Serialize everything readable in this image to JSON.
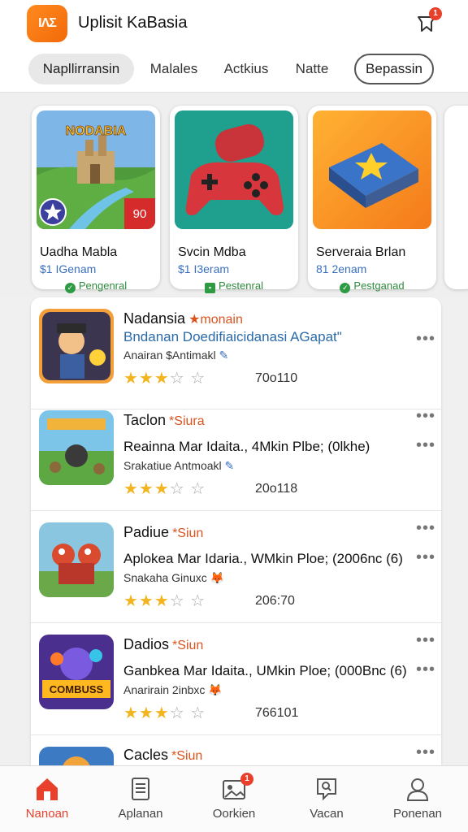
{
  "header": {
    "app_logo_text": "ΙΛΣ",
    "title": "Uplisit KaBasia",
    "notification_count": "1"
  },
  "tabs": [
    {
      "label": "Napllirransin",
      "state": "active"
    },
    {
      "label": "Malales",
      "state": "normal"
    },
    {
      "label": "Actkius",
      "state": "normal"
    },
    {
      "label": "Natte",
      "state": "normal"
    },
    {
      "label": "Bepassin",
      "state": "outlined"
    }
  ],
  "featured": [
    {
      "title": "Uadha Mabla",
      "price": "$1 IGenam",
      "status": "Pengenral",
      "art_label": "NODABIA",
      "badge": "90"
    },
    {
      "title": "Svcin Mdba",
      "price": "$1 I3eram",
      "status": "Pestenral",
      "art_label": "",
      "badge": ""
    },
    {
      "title": "Serveraia Brlan",
      "price": "81 2enam",
      "status": "Pestganad",
      "art_label": "",
      "badge": ""
    }
  ],
  "list": [
    {
      "name": "Nadansia",
      "tag": "monain",
      "desc": "Bndanan Doedifiaicidanasi AGapat\"",
      "desc_color": "blue",
      "sub": "Anairan $Antimakl",
      "rating": 3,
      "count": "70o110"
    },
    {
      "name": "Taclon",
      "tag": "Siura",
      "desc": "Reainna Mar Idaita., 4Mkin Plbe; (0lkhe)",
      "desc_color": "black",
      "sub": "Srakatiue Antmoakl",
      "rating": 3,
      "count": "20o118"
    },
    {
      "name": "Padiue",
      "tag": "Siun",
      "desc": "Aplokea Mar Idaria., WMkin Ploe; (2006nc (6)",
      "desc_color": "black",
      "sub": "Snakaha Ginuxc",
      "rating": 3,
      "count": "206:70"
    },
    {
      "name": "Dadios",
      "tag": "Siun",
      "desc": "Ganbkea Mar Idaita., UMkin Ploe; (000Bnc (6)",
      "desc_color": "black",
      "sub": "Anarirain 2inbxc",
      "rating": 3,
      "count": "766101"
    },
    {
      "name": "Cacles",
      "tag": "Siun",
      "desc": "",
      "desc_color": "black",
      "sub": "",
      "rating": 0,
      "count": ""
    }
  ],
  "list_art": [
    "COMBUSS"
  ],
  "bottom_nav": [
    {
      "label": "Nanoan",
      "icon": "home-icon",
      "active": true
    },
    {
      "label": "Aplanan",
      "icon": "document-icon",
      "active": false
    },
    {
      "label": "Oorkien",
      "icon": "gallery-icon",
      "active": false,
      "badge": "1"
    },
    {
      "label": "Vacan",
      "icon": "search-tag-icon",
      "active": false
    },
    {
      "label": "Ponenan",
      "icon": "profile-icon",
      "active": false
    }
  ],
  "colors": {
    "accent": "#e8402b",
    "logo": "#f26a0a",
    "star": "#f2b51f",
    "tag": "#d9541e",
    "price": "#3a6fbf",
    "ok": "#2e8b3e"
  }
}
